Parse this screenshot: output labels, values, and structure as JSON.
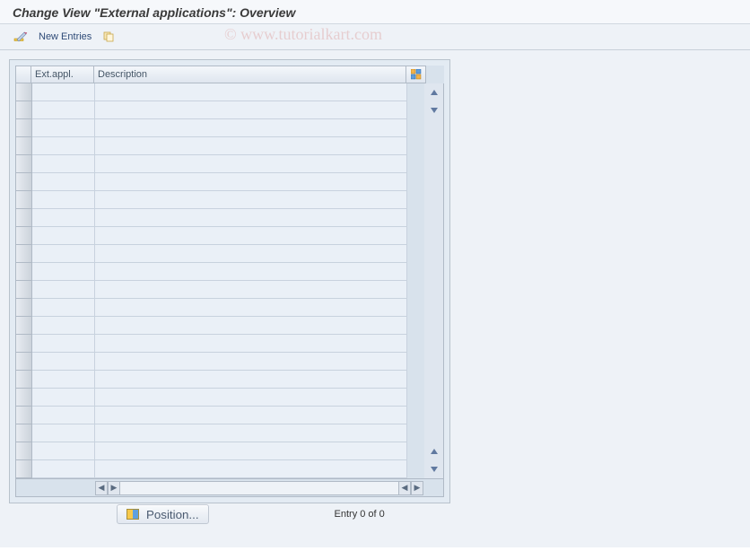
{
  "page": {
    "title": "Change View \"External applications\": Overview"
  },
  "toolbar": {
    "new_entries_label": "New Entries"
  },
  "watermark": "© www.tutorialkart.com",
  "table": {
    "columns": {
      "ext_appl": "Ext.appl.",
      "description": "Description"
    },
    "rows": [
      {
        "ext_appl": "",
        "description": ""
      },
      {
        "ext_appl": "",
        "description": ""
      },
      {
        "ext_appl": "",
        "description": ""
      },
      {
        "ext_appl": "",
        "description": ""
      },
      {
        "ext_appl": "",
        "description": ""
      },
      {
        "ext_appl": "",
        "description": ""
      },
      {
        "ext_appl": "",
        "description": ""
      },
      {
        "ext_appl": "",
        "description": ""
      },
      {
        "ext_appl": "",
        "description": ""
      },
      {
        "ext_appl": "",
        "description": ""
      },
      {
        "ext_appl": "",
        "description": ""
      },
      {
        "ext_appl": "",
        "description": ""
      },
      {
        "ext_appl": "",
        "description": ""
      },
      {
        "ext_appl": "",
        "description": ""
      },
      {
        "ext_appl": "",
        "description": ""
      },
      {
        "ext_appl": "",
        "description": ""
      },
      {
        "ext_appl": "",
        "description": ""
      },
      {
        "ext_appl": "",
        "description": ""
      },
      {
        "ext_appl": "",
        "description": ""
      },
      {
        "ext_appl": "",
        "description": ""
      },
      {
        "ext_appl": "",
        "description": ""
      },
      {
        "ext_appl": "",
        "description": ""
      }
    ]
  },
  "footer": {
    "position_label": "Position...",
    "entry_status": "Entry 0 of 0"
  }
}
